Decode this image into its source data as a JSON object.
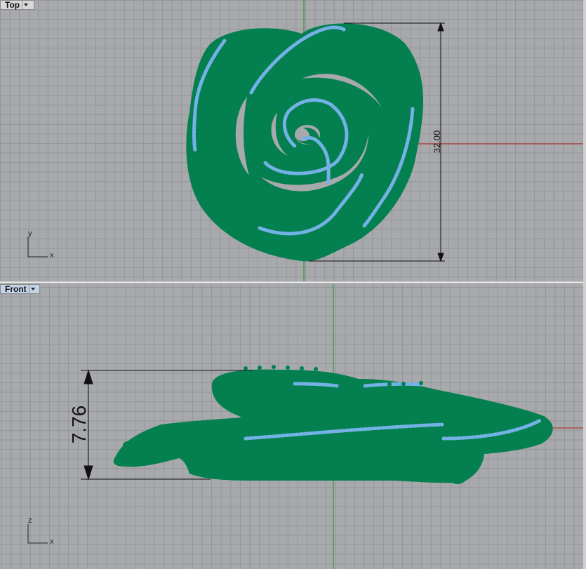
{
  "viewports": {
    "top": {
      "label": "Top",
      "dimension": "32.00",
      "axis_h": "x",
      "axis_v": "y"
    },
    "front": {
      "label": "Front",
      "dimension": "7.76",
      "axis_h": "x",
      "axis_v": "z"
    }
  },
  "colors": {
    "model": "#047f4f",
    "gems": "#74b2e6",
    "grid_bg": "#a7a9ac",
    "grid_line": "#939598",
    "x_axis": "#b23a3a",
    "y_axis": "#2e9b3a"
  },
  "icons": {
    "viewport_menu": "chevron-down-icon"
  }
}
